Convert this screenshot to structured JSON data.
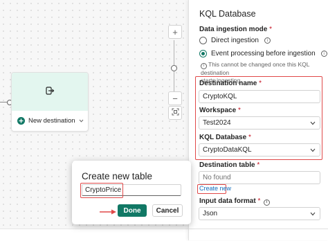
{
  "canvas": {
    "destination_card": {
      "label": "New destination"
    },
    "zoom": {
      "in_label": "+",
      "out_label": "−"
    }
  },
  "panel": {
    "title": "KQL Database",
    "ingestion_mode": {
      "label": "Data ingestion mode",
      "required": "*",
      "options": [
        {
          "label": "Direct ingestion",
          "selected": false
        },
        {
          "label": "Event processing before ingestion",
          "selected": true
        }
      ],
      "note_line1": "This cannot be changed once this KQL destination",
      "note_line2": "starts ingesting."
    },
    "destination_name": {
      "label": "Destination name",
      "required": "*",
      "value": "CryptoKQL"
    },
    "workspace": {
      "label": "Workspace",
      "required": "*",
      "value": "Test2024"
    },
    "kql_database": {
      "label": "KQL Database",
      "required": "*",
      "value": "CryptoDataKQL"
    },
    "destination_table": {
      "label": "Destination table",
      "required": "*",
      "placeholder": "No found",
      "create_link": "Create new"
    },
    "input_format": {
      "label": "Input data format",
      "required": "*",
      "value": "Json"
    }
  },
  "dialog": {
    "title": "Create new table",
    "input_value": "CryptoPrice",
    "done_label": "Done",
    "cancel_label": "Cancel"
  },
  "colors": {
    "accent": "#117865",
    "highlight": "#e04848",
    "link": "#0f6cbd"
  }
}
